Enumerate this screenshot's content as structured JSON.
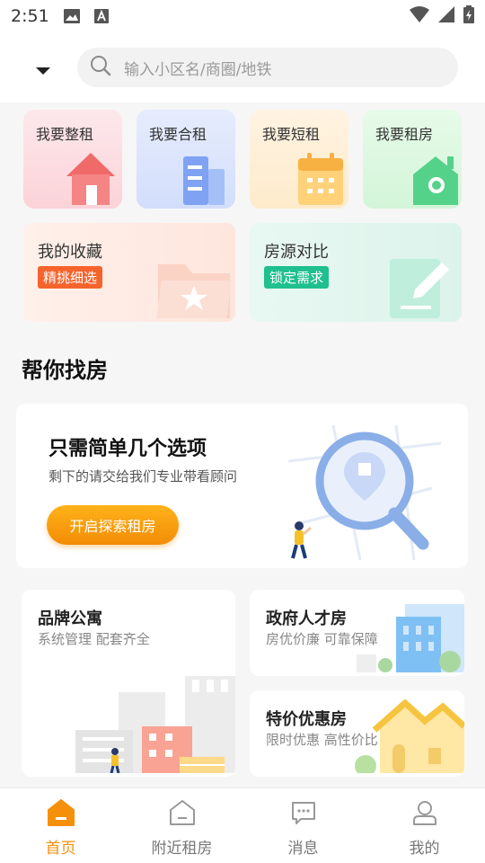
{
  "status_bar": {
    "time": "2:51"
  },
  "search": {
    "placeholder": "输入小区名/商圈/地铁"
  },
  "quick_tiles": [
    {
      "label": "我要整租"
    },
    {
      "label": "我要合租"
    },
    {
      "label": "我要短租"
    },
    {
      "label": "我要租房"
    }
  ],
  "feature_tiles": [
    {
      "title": "我的收藏",
      "badge": "精挑细选",
      "badge_color": "#f6632c"
    },
    {
      "title": "房源对比",
      "badge": "锁定需求",
      "badge_color": "#1fc08e"
    }
  ],
  "help_section": {
    "title": "帮你找房",
    "card_title": "只需简单几个选项",
    "card_subtitle": "剩下的请交给我们专业带看顾问",
    "button_label": "开启探索租房"
  },
  "apartment_cards": [
    {
      "title": "品牌公寓",
      "subtitle": "系统管理 配套齐全"
    },
    {
      "title": "政府人才房",
      "subtitle": "房优价廉 可靠保障"
    },
    {
      "title": "特价优惠房",
      "subtitle": "限时优惠 高性价比"
    }
  ],
  "tabbar": {
    "items": [
      {
        "label": "首页",
        "active": true
      },
      {
        "label": "附近租房",
        "active": false
      },
      {
        "label": "消息",
        "active": false
      },
      {
        "label": "我的",
        "active": false
      }
    ]
  },
  "colors": {
    "accent": "#f5900a"
  }
}
